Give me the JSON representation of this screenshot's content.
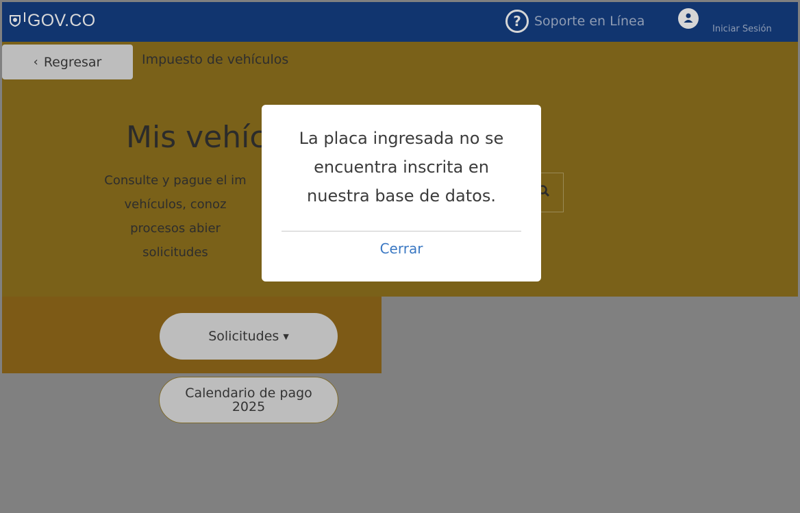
{
  "header": {
    "brand": "GOV.CO",
    "support_label": "Soporte en Línea",
    "login_label": "Iniciar Sesión"
  },
  "nav": {
    "back_label": "Regresar",
    "breadcrumb": "Impuesto de vehículos"
  },
  "hero": {
    "title": "Mis vehíc",
    "description_lines": [
      "Consulte y pague el im",
      "vehículos, conoz",
      "procesos abier",
      "solicitudes"
    ]
  },
  "actions": {
    "solicitudes_label": "Solicitudes",
    "calendario_line1": "Calendario de pago",
    "calendario_line2": "2025"
  },
  "modal": {
    "message_lines": [
      "La placa ingresada no se",
      "encuentra inscrita en",
      "nuestra base de datos."
    ],
    "close_label": "Cerrar"
  },
  "colors": {
    "topbar": "#11356f",
    "hero": "#7a6119",
    "link": "#3a78c3"
  }
}
